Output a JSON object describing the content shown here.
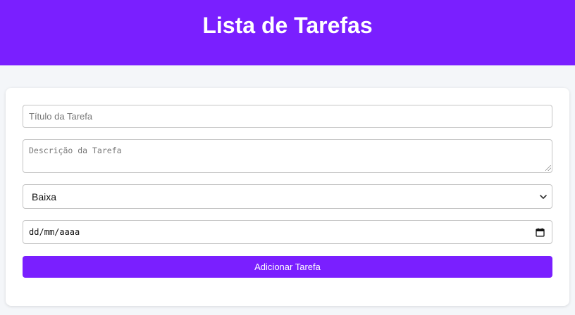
{
  "header": {
    "title": "Lista de Tarefas"
  },
  "form": {
    "title_placeholder": "Título da Tarefa",
    "description_placeholder": "Descrição da Tarefa",
    "priority_selected": "Baixa",
    "date_placeholder": "dd/mm/aaaa",
    "submit_label": "Adicionar Tarefa"
  },
  "icons": {
    "priority_dropdown": "chevron-down-icon",
    "date_picker": "calendar-icon",
    "description_resize": "resize-grip-icon"
  },
  "colors": {
    "accent": "#7a1fff",
    "background": "#f4f6f9",
    "card": "#ffffff"
  }
}
